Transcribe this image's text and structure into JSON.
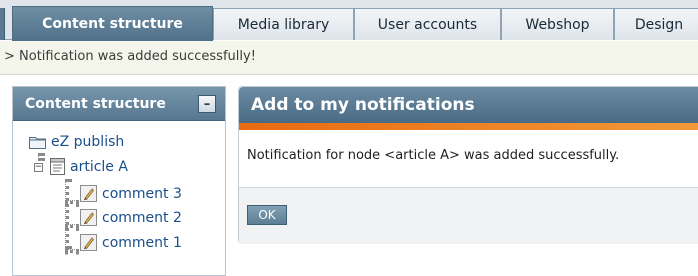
{
  "tabs": [
    {
      "label": "Content structure",
      "active": true
    },
    {
      "label": "Media library",
      "active": false
    },
    {
      "label": "User accounts",
      "active": false
    },
    {
      "label": "Webshop",
      "active": false
    },
    {
      "label": "Design",
      "active": false
    }
  ],
  "message": "> Notification was added successfully!",
  "left_panel": {
    "title": "Content structure",
    "collapse_glyph": "–",
    "tree": {
      "root": {
        "label": "eZ publish",
        "icon": "folder-icon"
      },
      "article": {
        "label": "article A",
        "icon": "document-icon"
      },
      "comments": [
        {
          "label": "comment 3",
          "icon": "comment-icon"
        },
        {
          "label": "comment 2",
          "icon": "comment-icon"
        },
        {
          "label": "comment 1",
          "icon": "comment-icon"
        }
      ]
    }
  },
  "right_panel": {
    "title": "Add to my notifications",
    "body_text": "Notification for node <article A> was added successfully.",
    "ok_label": "OK"
  },
  "colors": {
    "header_blue": "#56778f",
    "accent_orange": "#e86a12",
    "link_blue": "#1a4f8a"
  }
}
